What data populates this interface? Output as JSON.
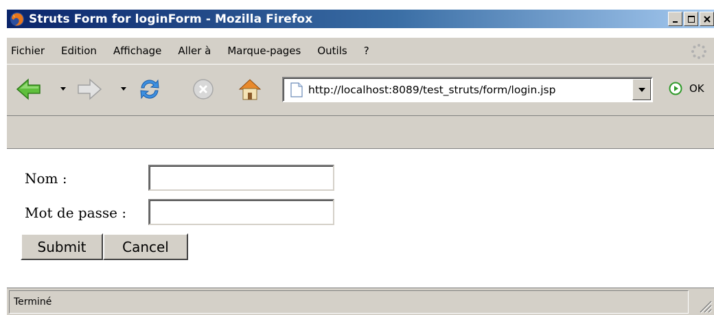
{
  "window": {
    "title": "Struts Form for loginForm - Mozilla Firefox"
  },
  "menu": {
    "items": [
      "Fichier",
      "Edition",
      "Affichage",
      "Aller à",
      "Marque-pages",
      "Outils",
      "?"
    ]
  },
  "toolbar": {
    "url": "http://localhost:8089/test_struts/form/login.jsp",
    "go_label": "OK"
  },
  "form": {
    "name_label": "Nom :",
    "name_value": "",
    "password_label": "Mot de passe :",
    "password_value": "",
    "submit_label": "Submit",
    "cancel_label": "Cancel"
  },
  "status": {
    "text": "Terminé"
  },
  "colors": {
    "title_gradient_start": "#0a246a",
    "title_gradient_end": "#a6caf0",
    "chrome": "#d4d0c8"
  },
  "icons": {
    "app": "firefox-icon",
    "back": "back-arrow-icon",
    "forward": "forward-arrow-icon",
    "reload": "reload-icon",
    "stop": "stop-icon",
    "home": "home-icon",
    "page": "page-icon",
    "go": "go-icon",
    "throbber": "throbber-icon"
  }
}
